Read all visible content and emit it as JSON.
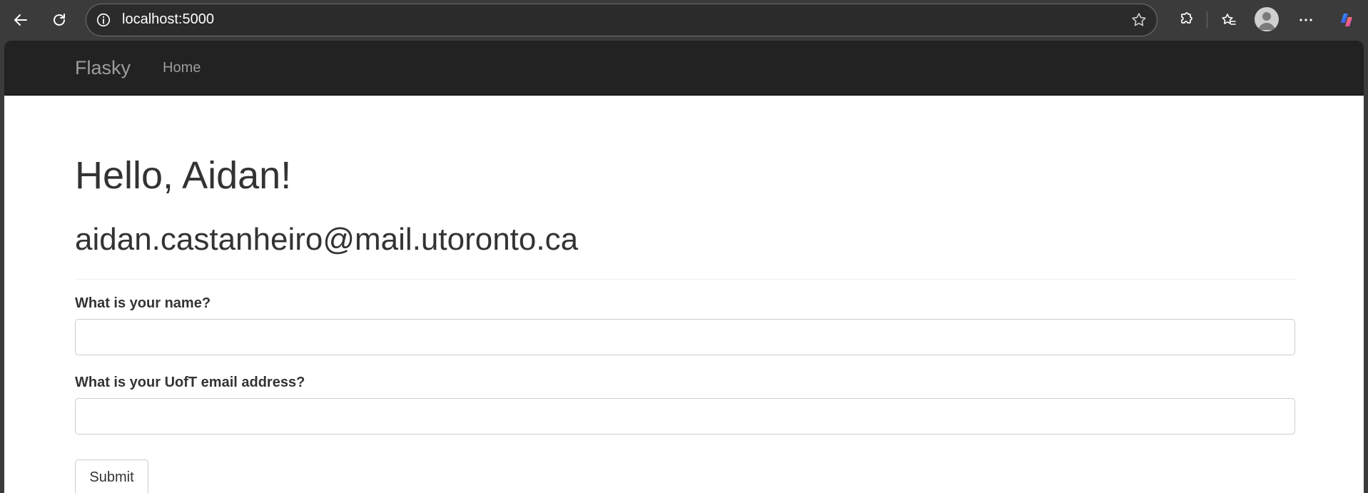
{
  "browser": {
    "url": "localhost:5000",
    "icons": [
      "back-icon",
      "refresh-icon",
      "info-icon",
      "favorite-star-icon",
      "extensions-icon",
      "favorites-icon",
      "profile-icon",
      "more-icon",
      "copilot-icon"
    ]
  },
  "navbar": {
    "brand": "Flasky",
    "links": [
      "Home"
    ]
  },
  "main": {
    "greeting": "Hello, Aidan!",
    "email": "aidan.castanheiro@mail.utoronto.ca"
  },
  "form": {
    "name_label": "What is your name?",
    "name_value": "",
    "email_label": "What is your UofT email address?",
    "email_value": "",
    "submit_label": "Submit"
  },
  "colors": {
    "browser_chrome": "#3b3b3b",
    "navbar_bg": "#222222",
    "navbar_text": "#9d9d9d",
    "text": "#333333"
  }
}
